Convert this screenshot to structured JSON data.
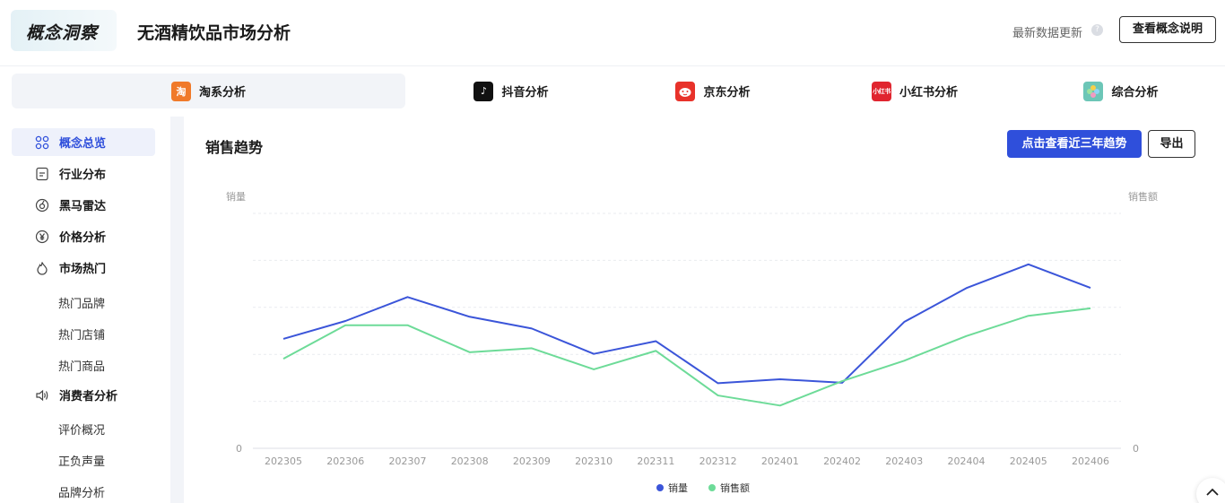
{
  "header": {
    "brand": "概念洞察",
    "title": "无酒精饮品市场分析",
    "update_text": "最新数据更新",
    "help_glyph": "?",
    "explain_button": "查看概念说明"
  },
  "tabs": [
    {
      "label": "淘系分析",
      "icon_text": "淘",
      "color": "#f07a2a",
      "active": true
    },
    {
      "label": "抖音分析",
      "icon_text": "♪",
      "color": "#111111",
      "active": false
    },
    {
      "label": "京东分析",
      "icon_text": "",
      "color": "#e8322a",
      "active": false
    },
    {
      "label": "小红书分析",
      "icon_text": "小红书",
      "color": "#e0252f",
      "active": false
    },
    {
      "label": "综合分析",
      "icon_text": "",
      "color": "#6cc6b7",
      "active": false
    }
  ],
  "sidebar": {
    "items": [
      {
        "label": "概念总览",
        "icon": "grid-icon",
        "active": true
      },
      {
        "label": "行业分布",
        "icon": "document-icon"
      },
      {
        "label": "黑马雷达",
        "icon": "radar-icon"
      },
      {
        "label": "价格分析",
        "icon": "yuan-icon"
      },
      {
        "label": "市场热门",
        "icon": "flame-icon"
      }
    ],
    "market_sub": [
      "热门品牌",
      "热门店铺",
      "热门商品"
    ],
    "consumer": {
      "label": "消费者分析",
      "icon": "speaker-icon"
    },
    "consumer_sub": [
      "评价概况",
      "正负声量",
      "品牌分析"
    ]
  },
  "main": {
    "section_title": "销售趋势",
    "trend_button": "点击查看近三年趋势",
    "export_button": "导出"
  },
  "colors": {
    "accent": "#2f4fdb",
    "series_volume": "#3b55d9",
    "series_sales": "#6ddb98"
  },
  "chart_data": {
    "type": "line",
    "x": [
      "202305",
      "202306",
      "202307",
      "202308",
      "202309",
      "202310",
      "202311",
      "202312",
      "202401",
      "202402",
      "202403",
      "202404",
      "202405",
      "202406"
    ],
    "left_axis_label": "销量",
    "right_axis_label": "销售额",
    "left_zero_label": "0",
    "right_zero_label": "0",
    "ylim": [
      0,
      100
    ],
    "grid": true,
    "legend_position": "bottom",
    "series": [
      {
        "name": "销量",
        "axis": "left",
        "values": [
          46.6,
          54.2,
          64.4,
          56.0,
          51.0,
          40.2,
          45.6,
          27.7,
          29.4,
          27.9,
          53.8,
          68.2,
          78.3,
          68.3
        ]
      },
      {
        "name": "销售额",
        "axis": "right",
        "values": [
          38.1,
          52.4,
          52.4,
          40.9,
          42.6,
          33.6,
          41.5,
          22.5,
          18.2,
          28.6,
          37.3,
          47.8,
          56.4,
          59.6
        ]
      }
    ]
  }
}
